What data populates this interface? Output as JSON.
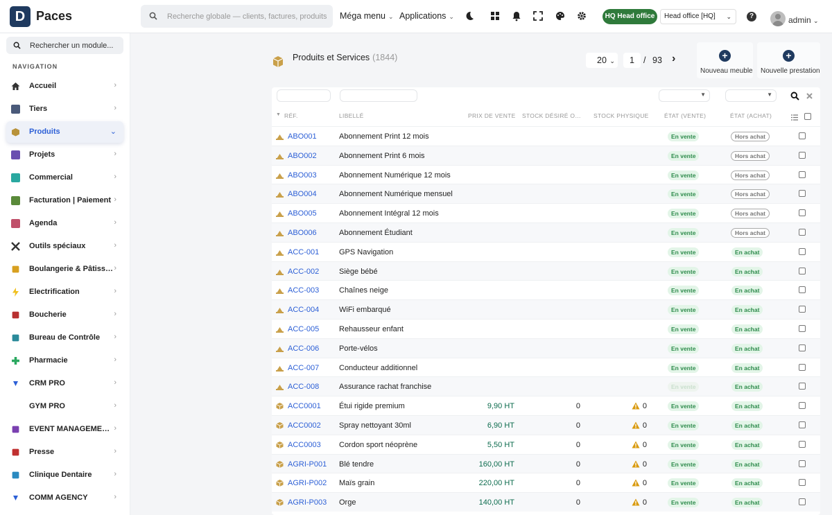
{
  "app": {
    "name": "Paces",
    "logo_letter": "D"
  },
  "topbar": {
    "search_placeholder": "Recherche globale — clients, factures, produits…",
    "mega_menu": "Méga menu",
    "applications": "Applications",
    "hq_badge": "HQ Head office",
    "hq_select": "Head office [HQ]",
    "help": "?",
    "user": "admin",
    "icons": [
      "moon-icon",
      "grid-icon",
      "bell-icon",
      "fullscreen-icon",
      "palette-icon",
      "gear-icon"
    ]
  },
  "sidebar": {
    "search_placeholder": "Rechercher un module...",
    "heading": "NAVIGATION",
    "items": [
      {
        "label": "Accueil",
        "icon": "home-icon",
        "color": "#333"
      },
      {
        "label": "Tiers",
        "icon": "building-icon",
        "color": "#4a5a7a"
      },
      {
        "label": "Produits",
        "icon": "box-icon",
        "color": "#b8923a"
      },
      {
        "label": "Projets",
        "icon": "project-icon",
        "color": "#6a4fb0"
      },
      {
        "label": "Commercial",
        "icon": "suitcase-icon",
        "color": "#2aa8a0"
      },
      {
        "label": "Facturation | Paiement",
        "icon": "invoice-icon",
        "color": "#5a8a3a"
      },
      {
        "label": "Agenda",
        "icon": "calendar-icon",
        "color": "#c0506a"
      },
      {
        "label": "Outils spéciaux",
        "icon": "tools-icon",
        "color": "#333"
      },
      {
        "label": "Boulangerie & Pâtiss…",
        "icon": "bread-icon",
        "color": "#d8a020"
      },
      {
        "label": "Electrification",
        "icon": "bolt-icon",
        "color": "#f0c020"
      },
      {
        "label": "Boucherie",
        "icon": "meat-icon",
        "color": "#b83030"
      },
      {
        "label": "Bureau de Contrôle",
        "icon": "control-icon",
        "color": "#2a8a9a"
      },
      {
        "label": "Pharmacie",
        "icon": "cross-icon",
        "color": "#2aa860"
      },
      {
        "label": "CRM PRO",
        "icon": "funnel-icon",
        "color": "#2c5fd6"
      },
      {
        "label": "GYM PRO",
        "icon": "",
        "color": "#fff"
      },
      {
        "label": "EVENT MANAGEME…",
        "icon": "event-icon",
        "color": "#7a40b0"
      },
      {
        "label": "Presse",
        "icon": "press-icon",
        "color": "#c03030"
      },
      {
        "label": "Clinique Dentaire",
        "icon": "tooth-icon",
        "color": "#2a8ac0"
      },
      {
        "label": "COMM AGENCY",
        "icon": "funnel-icon",
        "color": "#2c5fd6"
      }
    ]
  },
  "page": {
    "title": "Produits et Services",
    "count": "(1844)",
    "per_page": "20",
    "page": "1",
    "sep": "/",
    "total_pages": "93",
    "btn_new_furniture": "Nouveau meuble",
    "btn_new_service": "Nouvelle prestation"
  },
  "table": {
    "headers": [
      "RÉF.",
      "LIBELLÉ",
      "PRIX DE VENTE",
      "STOCK DÉSIRÉ O…",
      "STOCK PHYSIQUE",
      "ÉTAT (VENTE)",
      "ÉTAT (ACHAT)"
    ],
    "rows": [
      {
        "ref": "ABO001",
        "label": "Abonnement Print 12 mois",
        "price": "",
        "sd": "",
        "sp": "",
        "warn": false,
        "sale": "En vente",
        "sale_dim": false,
        "buy": "Hors achat",
        "buy_type": "h",
        "kind": "service"
      },
      {
        "ref": "ABO002",
        "label": "Abonnement Print 6 mois",
        "price": "",
        "sd": "",
        "sp": "",
        "warn": false,
        "sale": "En vente",
        "sale_dim": false,
        "buy": "Hors achat",
        "buy_type": "h",
        "kind": "service"
      },
      {
        "ref": "ABO003",
        "label": "Abonnement Numérique 12 mois",
        "price": "",
        "sd": "",
        "sp": "",
        "warn": false,
        "sale": "En vente",
        "sale_dim": false,
        "buy": "Hors achat",
        "buy_type": "h",
        "kind": "service"
      },
      {
        "ref": "ABO004",
        "label": "Abonnement Numérique mensuel",
        "price": "",
        "sd": "",
        "sp": "",
        "warn": false,
        "sale": "En vente",
        "sale_dim": false,
        "buy": "Hors achat",
        "buy_type": "h",
        "kind": "service"
      },
      {
        "ref": "ABO005",
        "label": "Abonnement Intégral 12 mois",
        "price": "",
        "sd": "",
        "sp": "",
        "warn": false,
        "sale": "En vente",
        "sale_dim": false,
        "buy": "Hors achat",
        "buy_type": "h",
        "kind": "service"
      },
      {
        "ref": "ABO006",
        "label": "Abonnement Étudiant",
        "price": "",
        "sd": "",
        "sp": "",
        "warn": false,
        "sale": "En vente",
        "sale_dim": false,
        "buy": "Hors achat",
        "buy_type": "h",
        "kind": "service"
      },
      {
        "ref": "ACC-001",
        "label": "GPS Navigation",
        "price": "",
        "sd": "",
        "sp": "",
        "warn": false,
        "sale": "En vente",
        "sale_dim": false,
        "buy": "En achat",
        "buy_type": "a",
        "kind": "service"
      },
      {
        "ref": "ACC-002",
        "label": "Siège bébé",
        "price": "",
        "sd": "",
        "sp": "",
        "warn": false,
        "sale": "En vente",
        "sale_dim": false,
        "buy": "En achat",
        "buy_type": "a",
        "kind": "service"
      },
      {
        "ref": "ACC-003",
        "label": "Chaînes neige",
        "price": "",
        "sd": "",
        "sp": "",
        "warn": false,
        "sale": "En vente",
        "sale_dim": false,
        "buy": "En achat",
        "buy_type": "a",
        "kind": "service"
      },
      {
        "ref": "ACC-004",
        "label": "WiFi embarqué",
        "price": "",
        "sd": "",
        "sp": "",
        "warn": false,
        "sale": "En vente",
        "sale_dim": false,
        "buy": "En achat",
        "buy_type": "a",
        "kind": "service"
      },
      {
        "ref": "ACC-005",
        "label": "Rehausseur enfant",
        "price": "",
        "sd": "",
        "sp": "",
        "warn": false,
        "sale": "En vente",
        "sale_dim": false,
        "buy": "En achat",
        "buy_type": "a",
        "kind": "service"
      },
      {
        "ref": "ACC-006",
        "label": "Porte-vélos",
        "price": "",
        "sd": "",
        "sp": "",
        "warn": false,
        "sale": "En vente",
        "sale_dim": false,
        "buy": "En achat",
        "buy_type": "a",
        "kind": "service"
      },
      {
        "ref": "ACC-007",
        "label": "Conducteur additionnel",
        "price": "",
        "sd": "",
        "sp": "",
        "warn": false,
        "sale": "En vente",
        "sale_dim": false,
        "buy": "En achat",
        "buy_type": "a",
        "kind": "service"
      },
      {
        "ref": "ACC-008",
        "label": "Assurance rachat franchise",
        "price": "",
        "sd": "",
        "sp": "",
        "warn": false,
        "sale": "En vente",
        "sale_dim": true,
        "buy": "En achat",
        "buy_type": "a",
        "kind": "service"
      },
      {
        "ref": "ACC0001",
        "label": "Étui rigide premium",
        "price": "9,90 HT",
        "sd": "0",
        "sp": "0",
        "warn": true,
        "sale": "En vente",
        "sale_dim": false,
        "buy": "En achat",
        "buy_type": "a",
        "kind": "product"
      },
      {
        "ref": "ACC0002",
        "label": "Spray nettoyant 30ml",
        "price": "6,90 HT",
        "sd": "0",
        "sp": "0",
        "warn": true,
        "sale": "En vente",
        "sale_dim": false,
        "buy": "En achat",
        "buy_type": "a",
        "kind": "product"
      },
      {
        "ref": "ACC0003",
        "label": "Cordon sport néoprène",
        "price": "5,50 HT",
        "sd": "0",
        "sp": "0",
        "warn": true,
        "sale": "En vente",
        "sale_dim": false,
        "buy": "En achat",
        "buy_type": "a",
        "kind": "product"
      },
      {
        "ref": "AGRI-P001",
        "label": "Blé tendre",
        "price": "160,00 HT",
        "sd": "0",
        "sp": "0",
        "warn": true,
        "sale": "En vente",
        "sale_dim": false,
        "buy": "En achat",
        "buy_type": "a",
        "kind": "product"
      },
      {
        "ref": "AGRI-P002",
        "label": "Maïs grain",
        "price": "220,00 HT",
        "sd": "0",
        "sp": "0",
        "warn": true,
        "sale": "En vente",
        "sale_dim": false,
        "buy": "En achat",
        "buy_type": "a",
        "kind": "product"
      },
      {
        "ref": "AGRI-P003",
        "label": "Orge",
        "price": "140,00 HT",
        "sd": "0",
        "sp": "0",
        "warn": true,
        "sale": "En vente",
        "sale_dim": false,
        "buy": "En achat",
        "buy_type": "a",
        "kind": "product"
      }
    ]
  },
  "colors": {
    "brand": "#1f3a5f",
    "link": "#2c5fd6",
    "hq": "#2f7a3b",
    "price": "#0c6b4d",
    "product_icon": "#b8923a"
  }
}
